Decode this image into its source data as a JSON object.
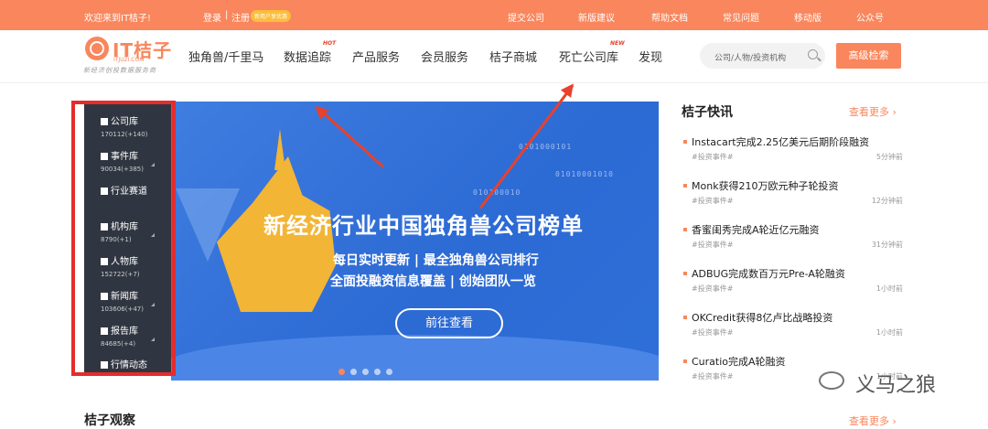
{
  "topbar": {
    "welcome": "欢迎来到IT桔子!",
    "login": "登录",
    "sep": "|",
    "register": "注册",
    "tag": "新用户享优惠",
    "links": [
      "提交公司",
      "新版建议",
      "帮助文档",
      "常见问题",
      "移动版",
      "公众号"
    ]
  },
  "logo": {
    "text": "IT桔子",
    "sub": "ITJUZI.COM",
    "slogan": "新经济创投数据服务商"
  },
  "nav": {
    "items": [
      "独角兽/千里马",
      "数据追踪",
      "产品服务",
      "会员服务",
      "桔子商城",
      "死亡公司库",
      "发现"
    ],
    "hot_badge": "HOT",
    "new_badge": "NEW"
  },
  "search": {
    "placeholder": "公司/人物/投资机构",
    "adv_button": "高级检索"
  },
  "sidebar": [
    {
      "label": "公司库",
      "count": "170112(+140)"
    },
    {
      "label": "事件库",
      "count": "90034(+385)"
    },
    {
      "label": "行业赛道",
      "count": ""
    },
    {
      "label": "机构库",
      "count": "8790(+1)"
    },
    {
      "label": "人物库",
      "count": "152722(+7)"
    },
    {
      "label": "新闻库",
      "count": "103606(+47)"
    },
    {
      "label": "报告库",
      "count": "84685(+4)"
    },
    {
      "label": "行情动态",
      "count": ""
    }
  ],
  "banner": {
    "title": "新经济行业中国独角兽公司榜单",
    "line1": "每日实时更新 | 最全独角兽公司排行",
    "line2": "全面投融资信息覆盖 | 创始团队一览",
    "button": "前往查看",
    "binary1": "0101000101",
    "binary2": "01010001010",
    "binary3": "010100010"
  },
  "news": {
    "title": "桔子快讯",
    "more": "查看更多 ›",
    "items": [
      {
        "title": "Instacart完成2.25亿美元后期阶段融资",
        "tag": "#投资事件#",
        "time": "5分钟前"
      },
      {
        "title": "Monk获得210万欧元种子轮投资",
        "tag": "#投资事件#",
        "time": "12分钟前"
      },
      {
        "title": "香蜜闺秀完成A轮近亿元融资",
        "tag": "#投资事件#",
        "time": "31分钟前"
      },
      {
        "title": "ADBUG完成数百万元Pre-A轮融资",
        "tag": "#投资事件#",
        "time": "1小时前"
      },
      {
        "title": "OKCredit获得8亿卢比战略投资",
        "tag": "#投资事件#",
        "time": "1小时前"
      },
      {
        "title": "Curatio完成A轮融资",
        "tag": "#投资事件#",
        "time": "1小时前"
      }
    ]
  },
  "section": {
    "title": "桔子观察",
    "more": "查看更多 ›"
  },
  "watermark": "义马之狼"
}
